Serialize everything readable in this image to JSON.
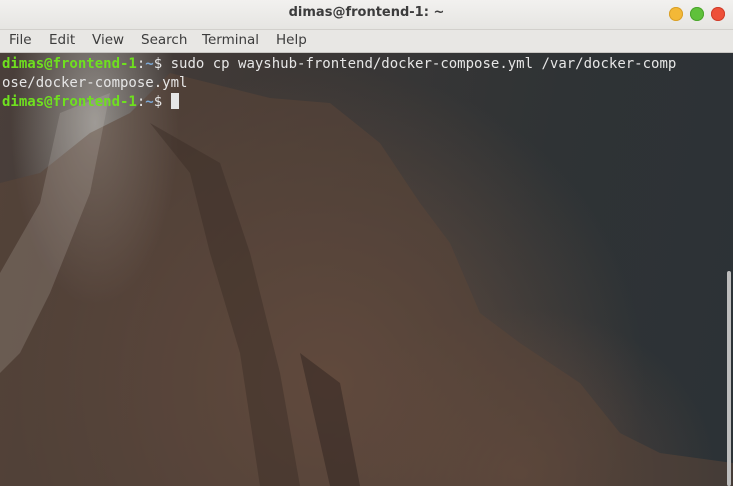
{
  "window": {
    "title": "dimas@frontend-1: ~"
  },
  "menu": {
    "items": [
      "File",
      "Edit",
      "View",
      "Search",
      "Terminal",
      "Help"
    ]
  },
  "terminal": {
    "lines": [
      {
        "prompt_user": "dimas@frontend-1",
        "prompt_sep": ":",
        "prompt_path": "~",
        "prompt_sym": "$ ",
        "command": "sudo cp wayshub-frontend/docker-compose.yml /var/docker-comp"
      },
      {
        "output": "ose/docker-compose.yml"
      },
      {
        "prompt_user": "dimas@frontend-1",
        "prompt_sep": ":",
        "prompt_path": "~",
        "prompt_sym": "$ ",
        "command": ""
      }
    ]
  },
  "colors": {
    "prompt_user": "#6fe01f",
    "prompt_path": "#7da9d6",
    "text": "#e6e6e6"
  }
}
